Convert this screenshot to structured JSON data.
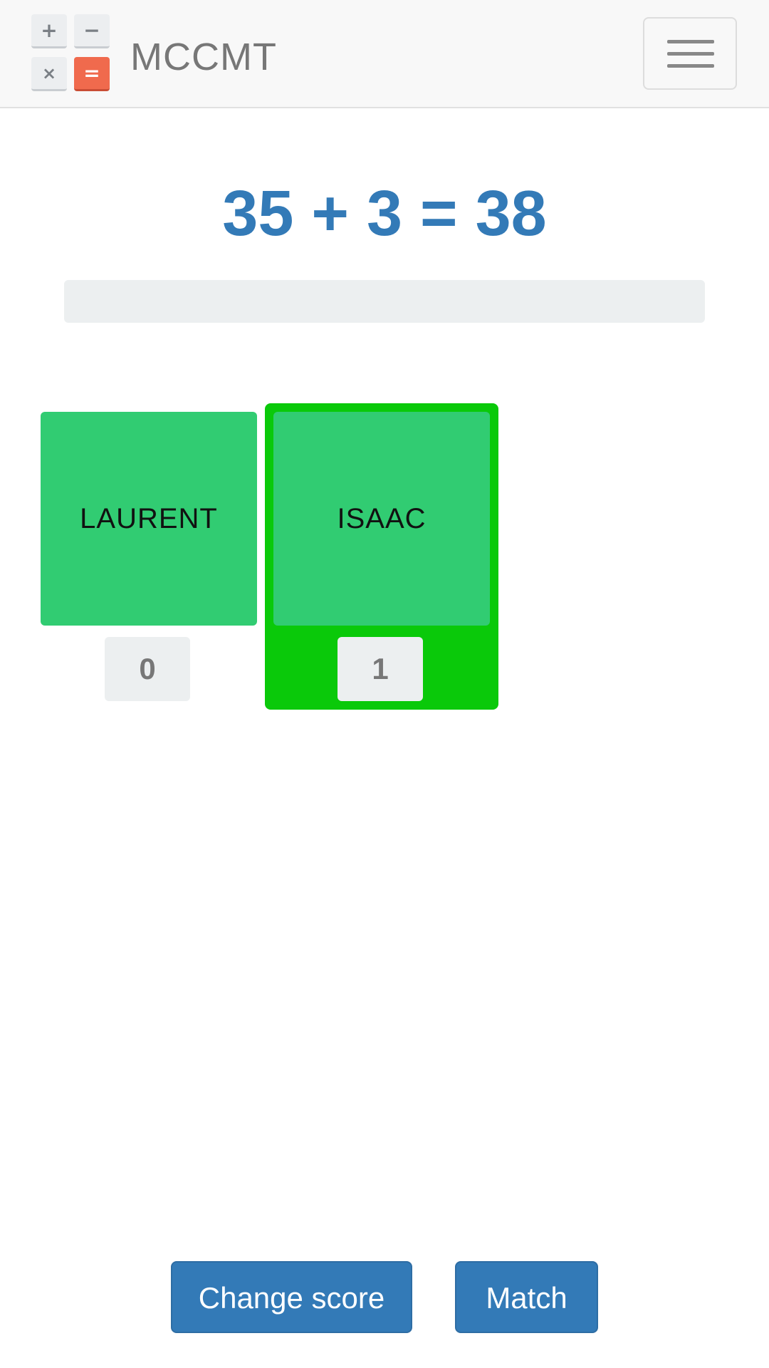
{
  "header": {
    "logo_keys": [
      "+",
      "−",
      "×",
      "="
    ],
    "brand": "MCCMT"
  },
  "game": {
    "equation": "35 + 3 = 38",
    "progress": 0
  },
  "players": [
    {
      "name": "LAURENT",
      "score": "0",
      "active": false
    },
    {
      "name": "ISAAC",
      "score": "1",
      "active": true
    }
  ],
  "actions": {
    "change_score": "Change score",
    "match": "Match"
  },
  "colors": {
    "brand_text": "#777777",
    "equation": "#337ab7",
    "card": "#31cc72",
    "active_player": "#0ac90a",
    "button": "#337ab7",
    "logo_accent": "#f06a4d"
  }
}
